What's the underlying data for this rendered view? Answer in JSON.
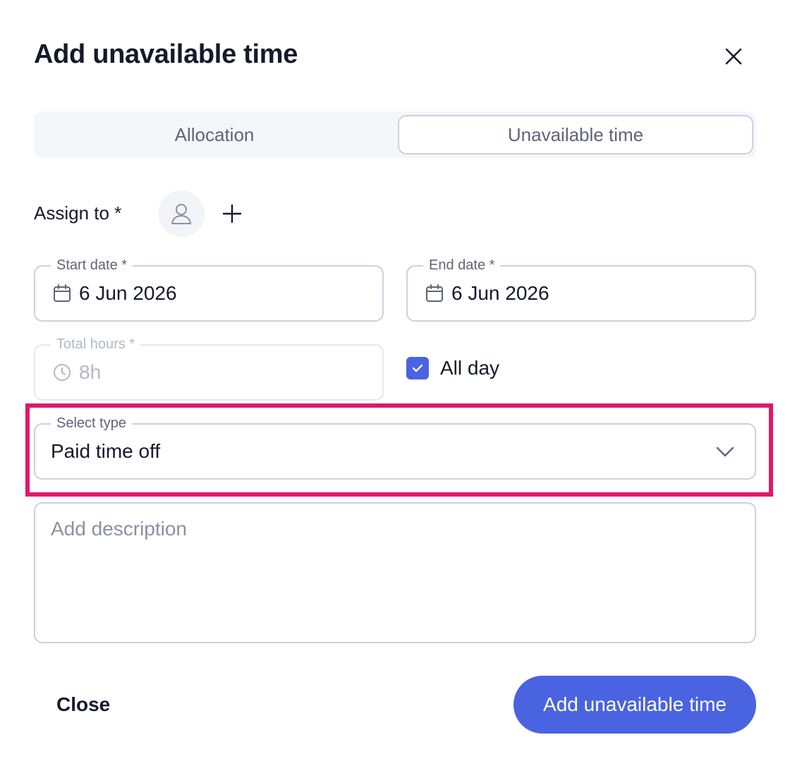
{
  "dialog": {
    "title": "Add unavailable time"
  },
  "tabs": [
    {
      "label": "Allocation",
      "active": false
    },
    {
      "label": "Unavailable time",
      "active": true
    }
  ],
  "assign": {
    "label": "Assign to *"
  },
  "start_date": {
    "label": "Start date *",
    "value": "6 Jun 2026"
  },
  "end_date": {
    "label": "End date *",
    "value": "6 Jun 2026"
  },
  "total_hours": {
    "label": "Total hours *",
    "value": "8h",
    "disabled": true
  },
  "all_day": {
    "label": "All day",
    "checked": true
  },
  "type_select": {
    "label": "Select type",
    "value": "Paid time off"
  },
  "description": {
    "placeholder": "Add description",
    "value": ""
  },
  "actions": {
    "close_label": "Close",
    "submit_label": "Add unavailable time"
  },
  "colors": {
    "primary": "#4a63e0",
    "highlight": "#e0186a",
    "border": "#cdd0e0",
    "tab_bg": "#f4f6fa"
  },
  "icons": [
    "close-icon",
    "user-icon",
    "plus-icon",
    "calendar-icon",
    "clock-icon",
    "check-icon",
    "chevron-down-icon"
  ]
}
